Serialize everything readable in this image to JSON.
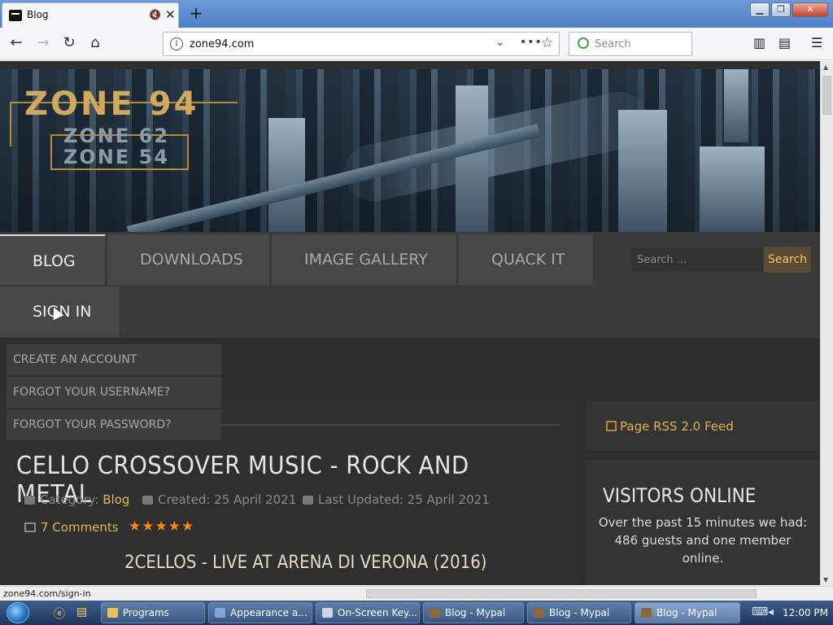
{
  "browser": {
    "tab_title": "Blog",
    "url": "zone94.com",
    "search_placeholder": "Search",
    "status_url": "zone94.com/sign-in"
  },
  "site": {
    "logo": {
      "main": "ZONE 94",
      "line2": "ZONE 62",
      "line3": "ZONE 54"
    },
    "nav": {
      "items": [
        {
          "label": "BLOG",
          "active": true
        },
        {
          "label": "DOWNLOADS"
        },
        {
          "label": "IMAGE GALLERY"
        },
        {
          "label": "QUACK IT"
        },
        {
          "label": "SIGN IN"
        }
      ],
      "search_placeholder": "Search ...",
      "search_button": "Search"
    },
    "signin_menu": [
      "CREATE AN ACCOUNT",
      "FORGOT YOUR USERNAME?",
      "FORGOT YOUR PASSWORD?"
    ],
    "article": {
      "title": "CELLO CROSSOVER MUSIC - ROCK AND METAL",
      "category_label": "Category:",
      "category": "Blog",
      "created": "Created: 25 April 2021",
      "updated": "Last Updated: 25 April 2021",
      "comments": "7 Comments",
      "rating_stars": 5,
      "stars": "★★★★★",
      "subtitle": "2CELLOS - LIVE AT ARENA DI VERONA (2016)"
    },
    "sidebar": {
      "rss_label": "Page RSS 2.0 Feed",
      "visitors_title": "VISITORS ONLINE",
      "visitors_text": "Over the past 15 minutes we had: 486 guests and one member online."
    }
  },
  "taskbar": {
    "tasks": [
      {
        "label": "Programs"
      },
      {
        "label": "Appearance a..."
      },
      {
        "label": "On-Screen Key..."
      },
      {
        "label": "Blog - Mypal"
      },
      {
        "label": "Blog - Mypal"
      },
      {
        "label": "Blog - Mypal"
      }
    ],
    "clock": "12:00 PM"
  },
  "colors": {
    "accent_gold": "#e4b44c",
    "page_bg": "#2e2e2e",
    "star_orange": "#f08a1c"
  }
}
